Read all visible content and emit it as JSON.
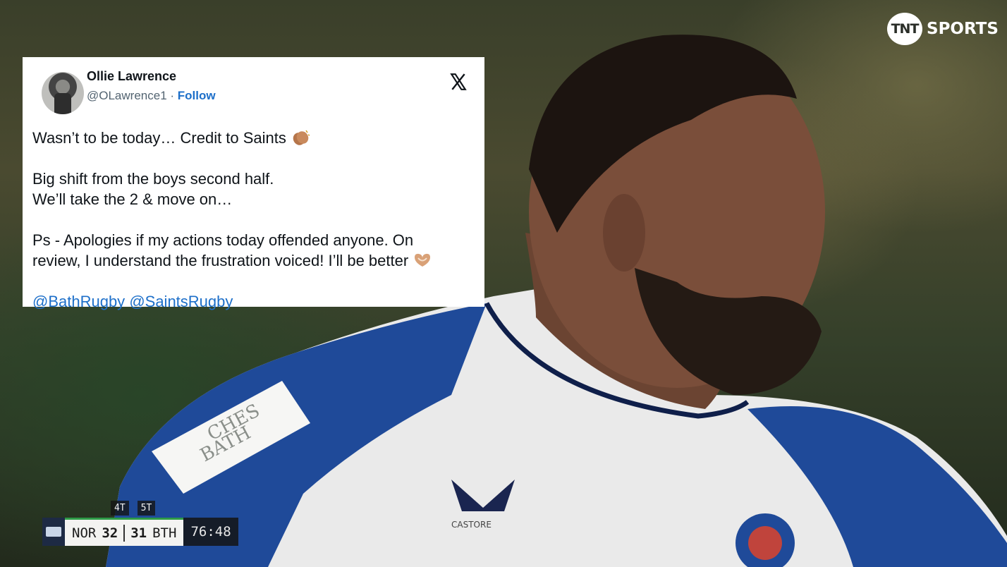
{
  "broadcaster": {
    "logo_mark": "TNT",
    "logo_word": "SPORTS"
  },
  "tweet": {
    "author_name": "Ollie Lawrence",
    "handle": "@OLawrence1",
    "separator": " · ",
    "follow_label": "Follow",
    "platform_icon": "x-logo-icon",
    "lines": {
      "l1": "Wasn’t to be today… Credit to Saints",
      "l2": "Big shift from the boys second half.",
      "l3": "We’ll take the 2 & move on…",
      "l4": "Ps - Apologies if my actions today offended anyone. On",
      "l5": "review, I understand the frustration voiced! I’ll be better"
    },
    "mentions": [
      "@BathRugby",
      "@SaintsRugby"
    ],
    "emojis": [
      "clapping-hands-icon",
      "heart-hands-icon"
    ]
  },
  "scoreboard": {
    "home_team": "NOR",
    "home_score": "32",
    "away_score": "31",
    "away_team": "BTH",
    "clock": "76:48",
    "home_tries": "4T",
    "away_tries": "5T"
  },
  "colors": {
    "link": "#1d6fc9",
    "score_accent": "#2e9b48",
    "jersey_blue": "#1f4a99"
  }
}
